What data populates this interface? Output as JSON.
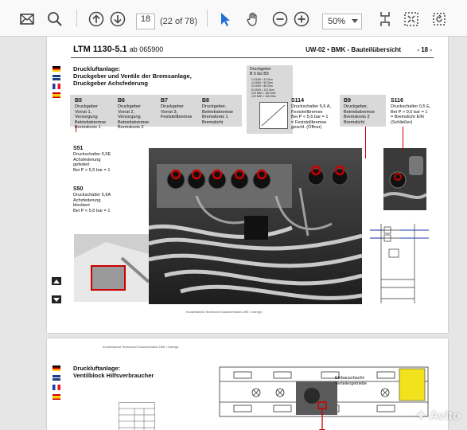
{
  "toolbar": {
    "page_current": "18",
    "page_count": "(22 of 78)",
    "zoom": "50%"
  },
  "page1": {
    "title": "LTM 1130-5.1",
    "title_ab": "ab 065900",
    "header_right": "UW-02 • BMK - Bauteilübersicht",
    "page_num": "- 18 -",
    "section_title": "Druckluftanlage:\nDruckgeber und Ventile der Bremsanlage,\nDruckgeber Achsfederung",
    "chart": {
      "title": "Druckgeber\nB 5 bis B9",
      "rows": [
        "2,0 BAR = 32 Ohm",
        "4,0 BAR = 56 Ohm",
        "6,0 BAR = 88 Ohm",
        "8,0 BAR = 120 Ohm",
        "10,0 BAR = 152 Ohm",
        "12,0 BAR = 180 Ohm"
      ]
    },
    "labels": {
      "b5": {
        "code": "B5",
        "text": "Druckgeber\nVorrat 1,\nVersorgung\nBetriebsbremse\nBremskreis 1"
      },
      "b6": {
        "code": "B6",
        "text": "Druckgeber\nVorrat 2,\nVersorgung\nBetriebsbremse\nBremskreis 2"
      },
      "b7": {
        "code": "B7",
        "text": "Druckgeber\nVorrat 3,\nFeststellbremse"
      },
      "b8": {
        "code": "B8",
        "text": "Druckgeber,\nBetriebsbremse\nBremskreis 1\nBremslicht"
      },
      "s114": {
        "code": "S114",
        "text": "Druckschalter 5,6 A,\nFeststellbremse\nBei P < 5,6 bar = 1\n= Feststellbremse\ngeschl. (Öffner)"
      },
      "b9": {
        "code": "B9",
        "text": "Druckgeber,\nBetriebsbremse\nBremskreis 2\nBremslicht"
      },
      "s116": {
        "code": "S116",
        "text": "Druckschalter 0,5 E,\nBei P > 0,5 bar = 1\n= Bremslicht EIN\n(Schließer)"
      },
      "s51": {
        "code": "S51",
        "text": "Druckschalter 5,5E\nAchsfederung\ngefedert\nBei P > 5,5 bar = 1"
      },
      "s50": {
        "code": "S50",
        "text": "Druckschalter 5,6A\nAchsfederung\nblockiert\nBei P < 5,6 bar = 1"
      }
    },
    "footer": "Kundendienst Technische Dokumentation LWE • lwierrgn"
  },
  "page2": {
    "section_title": "Druckluftanlage:\nVentilblock Hilfsverbraucher",
    "label_einbau": "Einbauschacht-\nVerteilergetriebe",
    "footer": "Kundendienst Technische Dokumentation LWE • lwierrgn"
  },
  "watermark": "Avito",
  "colors": {
    "accent": "#c00000",
    "gray_box": "#d9d9d9",
    "toolbar_bg": "#f9f9f9",
    "cursor_blue": "#1f6fd6"
  }
}
